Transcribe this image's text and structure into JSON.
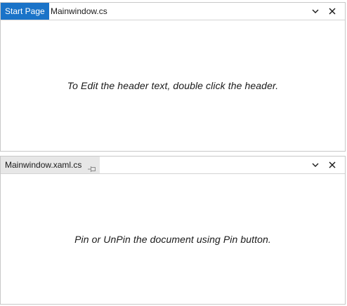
{
  "top_pane": {
    "tabs": [
      {
        "label": "Start Page",
        "state": "active"
      },
      {
        "label": "Mainwindow.cs",
        "state": "inactive"
      }
    ],
    "message": "To Edit the header text, double click the header."
  },
  "bottom_pane": {
    "tabs": [
      {
        "label": "Mainwindow.xaml.cs",
        "state": "pinned",
        "icon": "pin-icon"
      }
    ],
    "message": "Pin or UnPin the document using Pin button."
  },
  "icons": {
    "dropdown": "chevron-down-icon",
    "close": "close-icon",
    "pin": "pin-icon"
  },
  "colors": {
    "accent": "#1a73c8",
    "pinned_tab_bg": "#e7e7e7",
    "border": "#c8c8c8"
  }
}
